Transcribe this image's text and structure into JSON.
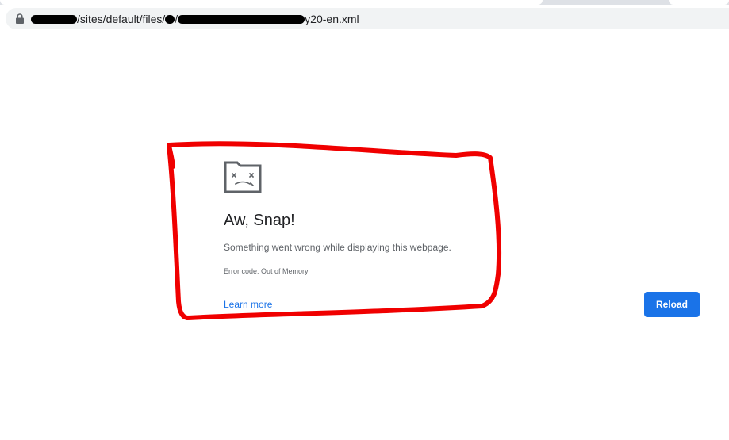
{
  "browser": {
    "address_bar": {
      "url_visible_parts": [
        "/sites/default/files/",
        "/",
        "y20-en.xml"
      ],
      "lock_icon": "lock-icon"
    }
  },
  "error_page": {
    "icon": "sad-tab-icon",
    "title": "Aw, Snap!",
    "message": "Something went wrong while displaying this webpage.",
    "error_code": "Error code: Out of Memory",
    "learn_more_label": "Learn more",
    "reload_label": "Reload"
  },
  "colors": {
    "accent": "#1a73e8",
    "annotation": "#f00000",
    "text_primary": "#202124",
    "text_secondary": "#5f6368"
  }
}
